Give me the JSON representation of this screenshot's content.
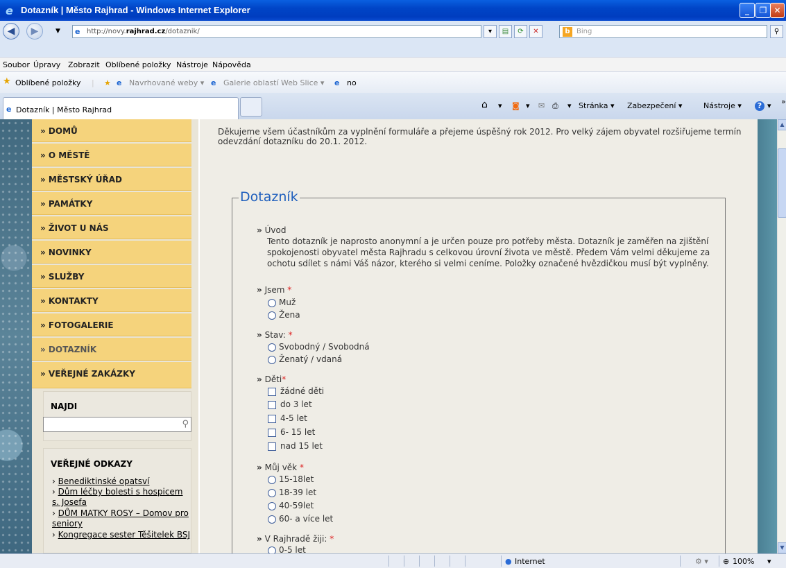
{
  "window": {
    "title": "Dotazník | Město Rajhrad - Windows Internet Explorer"
  },
  "address": {
    "url_prefix": "http://novy.",
    "url_domain": "rajhrad.cz",
    "url_path": "/dotaznik/",
    "search_placeholder": "Bing"
  },
  "menu": [
    "Soubor",
    "Úpravy",
    "Zobrazit",
    "Oblíbené položky",
    "Nástroje",
    "Nápověda"
  ],
  "favorites": {
    "label": "Oblíbené položky",
    "items": [
      "Navrhované weby ▾",
      "Galerie oblastí Web Slice ▾",
      "no"
    ]
  },
  "tab": {
    "title": "Dotazník | Město Rajhrad"
  },
  "commandbar": [
    "Stránka ▾",
    "Zabezpečení ▾",
    "Nástroje ▾"
  ],
  "nav": [
    "» DOMŮ",
    "» O MĚSTĚ",
    "» MĚSTSKÝ ÚŘAD",
    "» PAMÁTKY",
    "» ŽIVOT U NÁS",
    "» NOVINKY",
    "» SLUŽBY",
    "» KONTAKTY",
    "» FOTOGALERIE",
    "» DOTAZNÍK",
    "» VEŘEJNÉ ZAKÁZKY"
  ],
  "search": {
    "label": "NAJDI"
  },
  "links": {
    "label": "VEŘEJNÉ ODKAZY",
    "items": [
      "Benediktinské opatsví",
      "Dům léčby bolesti s hospicem s. Josefa",
      "DŮM MATKY ROSY – Domov pro seniory",
      "Kongregace sester Těšitelek BSJ"
    ]
  },
  "intro": "Děkujeme všem účastníkům za vyplnění formuláře a přejeme úspěšný rok 2012. Pro velký zájem obyvatel rozšiřujeme termín odevzdání dotazníku do 20.1. 2012.",
  "form": {
    "title": "Dotazník",
    "intro_label": "Úvod",
    "intro_text": "Tento dotazník je naprosto anonymní a je určen pouze pro potřeby města. Dotazník je zaměřen na zjištění spokojenosti obyvatel města Rajhradu s celkovou úrovní života ve městě. Předem Vám velmi děkujeme za ochotu sdílet s námi Váš názor, kterého si velmi ceníme. Položky označené hvězdičkou musí být vyplněny.",
    "questions": [
      {
        "label": "Jsem",
        "type": "radio",
        "options": [
          "Muž",
          "Žena"
        ]
      },
      {
        "label": "Stav:",
        "type": "radio",
        "options": [
          "Svobodný / Svobodná",
          "Ženatý / vdaná"
        ]
      },
      {
        "label": "Děti",
        "type": "checkbox",
        "options": [
          "žádné děti",
          "do 3 let",
          "4-5 let",
          "6- 15 let",
          "nad 15 let"
        ]
      },
      {
        "label": "Můj věk",
        "type": "radio",
        "options": [
          "15-18let",
          "18-39 let",
          "40-59let",
          "60- a více let"
        ]
      },
      {
        "label": "V Rajhradě žiji:",
        "type": "radio",
        "options": [
          "0-5 let"
        ]
      }
    ]
  },
  "status": {
    "zone": "Internet",
    "zoom": "100%"
  }
}
